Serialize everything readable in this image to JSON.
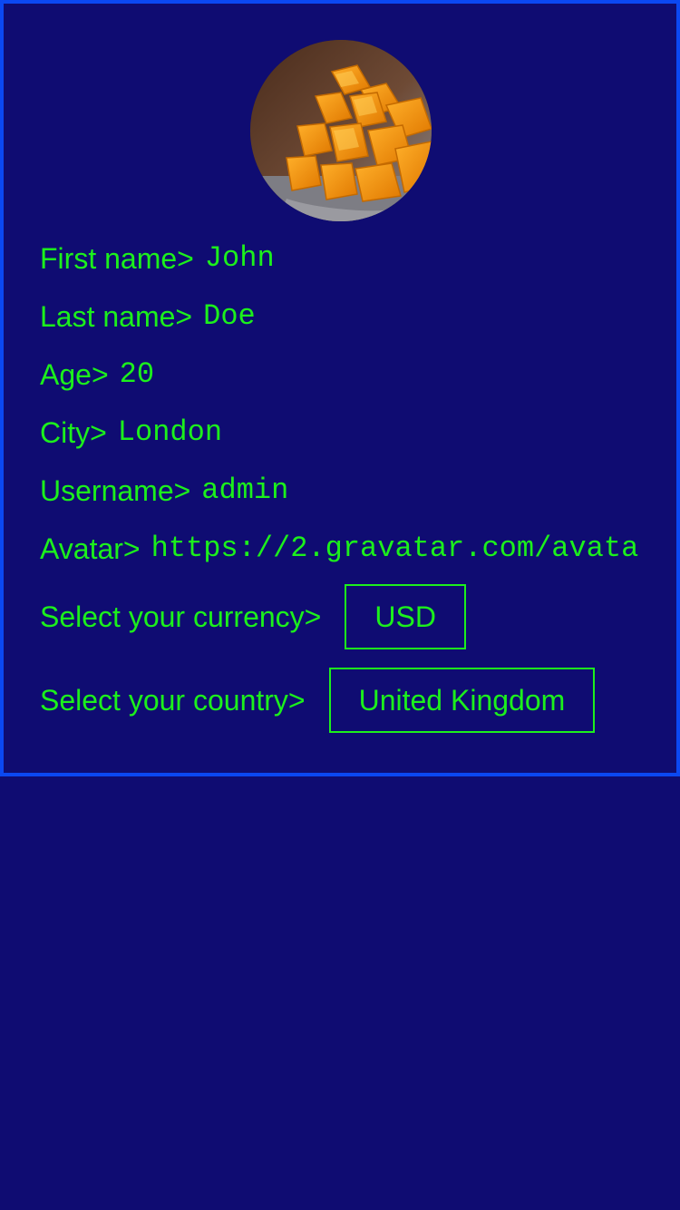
{
  "profile": {
    "avatar_alt": "mango",
    "fields": [
      {
        "label": "First name>",
        "value": "John"
      },
      {
        "label": "Last name>",
        "value": "Doe"
      },
      {
        "label": "Age>",
        "value": "20"
      },
      {
        "label": "City>",
        "value": "London"
      },
      {
        "label": "Username>",
        "value": "admin"
      },
      {
        "label": "Avatar>",
        "value": "https://2.gravatar.com/avata"
      }
    ],
    "currency": {
      "label": "Select your currency>",
      "selected": "USD"
    },
    "country": {
      "label": "Select your country>",
      "selected": "United Kingdom"
    }
  },
  "colors": {
    "background": "#0f0c72",
    "border": "#0b48f2",
    "text": "#1cf01c"
  }
}
